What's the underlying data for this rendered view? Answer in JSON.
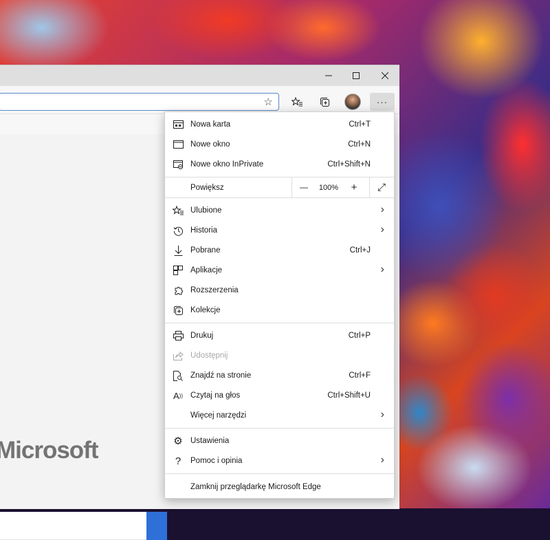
{
  "window": {
    "minimize_icon": "minimize-icon",
    "maximize_icon": "maximize-icon",
    "close_icon": "close-icon"
  },
  "toolbar": {
    "favorite_star_icon": "star-outline-icon",
    "favorites_icon": "favorites-list-icon",
    "collections_icon": "collections-icon",
    "more_icon": "ellipsis-icon",
    "more_label": "···"
  },
  "page": {
    "logo_text": "Microsoft"
  },
  "menu": {
    "new_tab": {
      "label": "Nowa karta",
      "shortcut": "Ctrl+T"
    },
    "new_window": {
      "label": "Nowe okno",
      "shortcut": "Ctrl+N"
    },
    "new_inprivate": {
      "label": "Nowe okno InPrivate",
      "shortcut": "Ctrl+Shift+N"
    },
    "zoom": {
      "label": "Powiększ",
      "minus": "—",
      "value": "100%",
      "plus": "+",
      "fullscreen": "⤢"
    },
    "favorites": {
      "label": "Ulubione"
    },
    "history": {
      "label": "Historia"
    },
    "downloads": {
      "label": "Pobrane",
      "shortcut": "Ctrl+J"
    },
    "apps": {
      "label": "Aplikacje"
    },
    "extensions": {
      "label": "Rozszerzenia"
    },
    "collections": {
      "label": "Kolekcje"
    },
    "print": {
      "label": "Drukuj",
      "shortcut": "Ctrl+P"
    },
    "share": {
      "label": "Udostępnij"
    },
    "find": {
      "label": "Znajdź na stronie",
      "shortcut": "Ctrl+F"
    },
    "read_aloud": {
      "label": "Czytaj na głos",
      "shortcut": "Ctrl+Shift+U"
    },
    "more_tools": {
      "label": "Więcej narzędzi"
    },
    "settings": {
      "label": "Ustawienia"
    },
    "help": {
      "label": "Pomoc i opinia"
    },
    "close_edge": {
      "label": "Zamknij przeglądarkę Microsoft Edge"
    },
    "submenu_arrow": "›"
  }
}
